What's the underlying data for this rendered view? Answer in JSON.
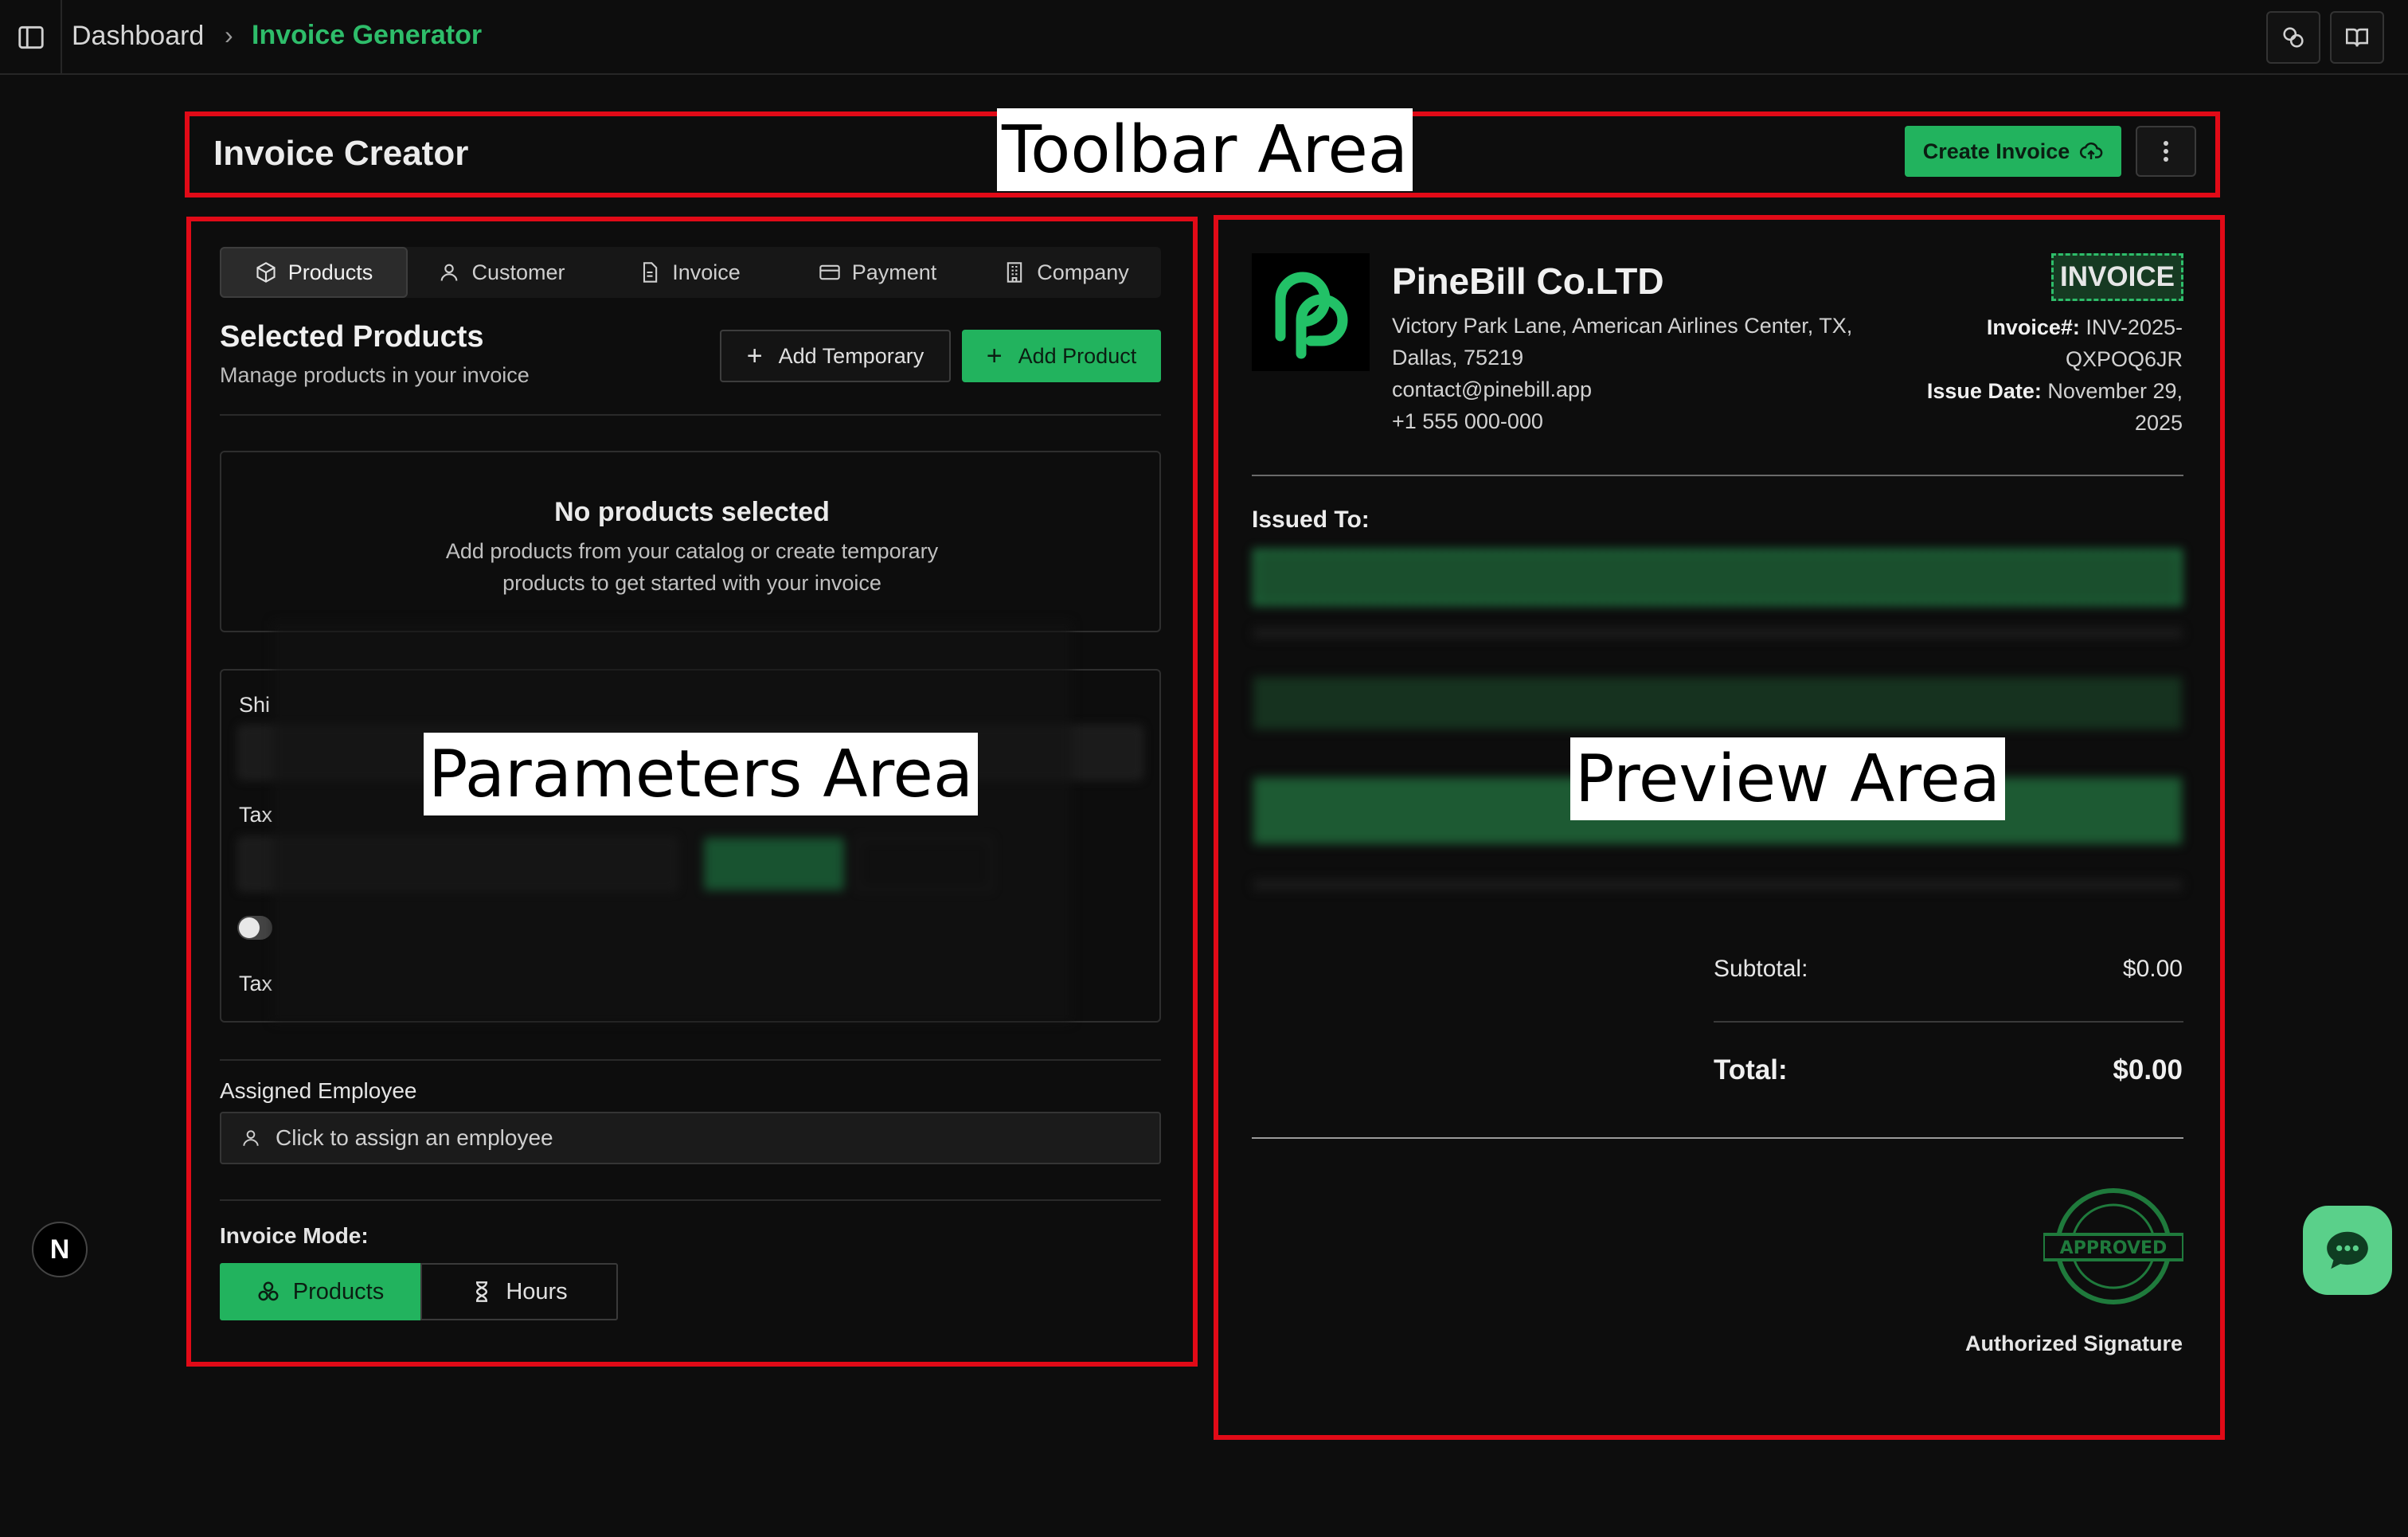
{
  "breadcrumb": {
    "root": "Dashboard",
    "separator": "›",
    "current": "Invoice Generator"
  },
  "annotations": {
    "toolbar": "Toolbar Area",
    "parameters": "Parameters Area",
    "preview": "Preview Area"
  },
  "toolbar": {
    "title": "Invoice Creator",
    "create_label": "Create Invoice"
  },
  "tabs": [
    {
      "label": "Products",
      "icon": "package-icon",
      "active": true
    },
    {
      "label": "Customer",
      "icon": "user-icon"
    },
    {
      "label": "Invoice",
      "icon": "file-icon"
    },
    {
      "label": "Payment",
      "icon": "credit-card-icon"
    },
    {
      "label": "Company",
      "icon": "building-icon"
    }
  ],
  "products": {
    "title": "Selected Products",
    "subtitle": "Manage products in your invoice",
    "add_temporary": "Add Temporary",
    "add_product": "Add Product",
    "empty_title": "No products selected",
    "empty_desc": "Add products from your catalog or create temporary products to get started with your invoice"
  },
  "params": {
    "shipping_label_visible": "Shi",
    "tax_label_visible": "Tax",
    "tax_note_visible": "Tax"
  },
  "employee": {
    "label": "Assigned Employee",
    "placeholder": "Click to assign an employee"
  },
  "mode": {
    "label": "Invoice Mode:",
    "products": "Products",
    "hours": "Hours"
  },
  "preview": {
    "company_name": "PineBill Co.LTD",
    "address_line1": "Victory Park Lane, American Airlines Center, TX,",
    "address_line2": "Dallas, 75219",
    "email": "contact@pinebill.app",
    "phone": "+1 555 000-000",
    "badge": "INVOICE",
    "invoice_no_label": "Invoice#:",
    "invoice_no_part1": "INV-2025-",
    "invoice_no_part2": "QXPOQ6JR",
    "issue_date_label": "Issue Date:",
    "issue_date_part1": "November 29,",
    "issue_date_part2": "2025",
    "issued_to": "Issued To:",
    "subtotal_label": "Subtotal:",
    "subtotal_value": "$0.00",
    "total_label": "Total:",
    "total_value": "$0.00",
    "signature_label": "Authorized Signature",
    "stamp_text": "APPROVED"
  },
  "colors": {
    "accent": "#22b35e",
    "annotation": "#e10a17",
    "background": "#0d0d0d"
  }
}
